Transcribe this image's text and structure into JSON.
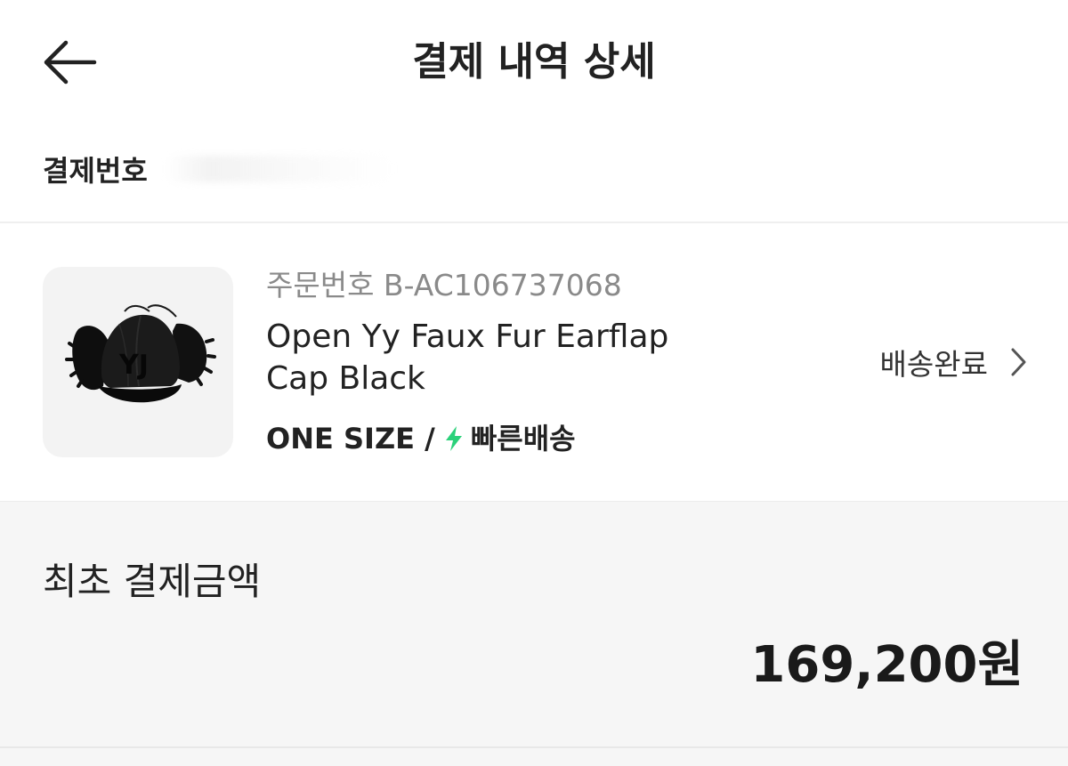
{
  "header": {
    "title": "결제 내역 상세",
    "back_icon": "arrow-left-icon"
  },
  "payment": {
    "number_label": "결제번호"
  },
  "order": {
    "order_number": "주문번호 B-AC106737068",
    "product_name": "Open Yy Faux Fur Earflap Cap Black",
    "option_size": "ONE SIZE /",
    "fast_delivery": "빠른배송",
    "fast_delivery_icon": "lightning-bolt-icon",
    "fast_delivery_color": "#2bd17a",
    "status": "배송완료",
    "status_icon": "chevron-right-icon"
  },
  "summary": {
    "label": "최초 결제금액",
    "amount": "169,200원"
  }
}
